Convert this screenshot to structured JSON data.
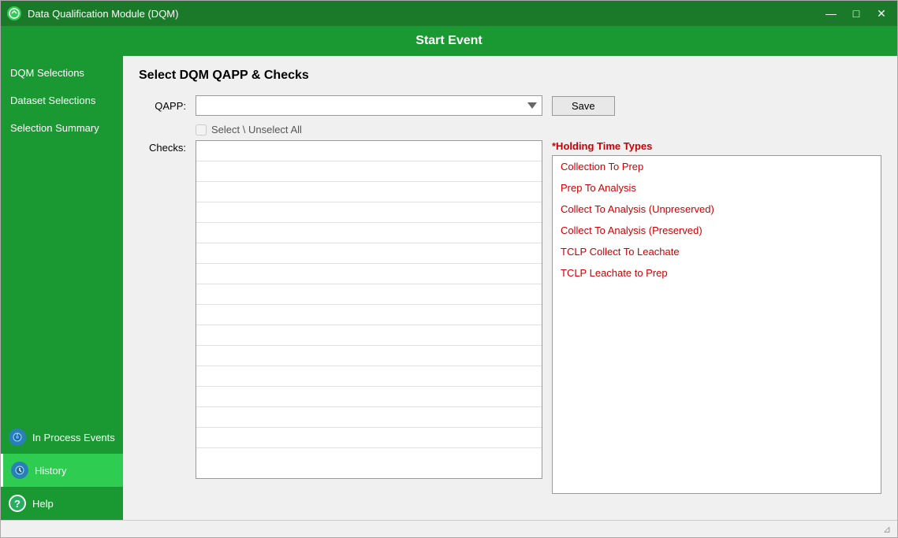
{
  "window": {
    "title": "Data Qualification Module (DQM)",
    "app_header": "Start Event"
  },
  "title_bar_controls": {
    "minimize": "—",
    "maximize": "□",
    "close": "✕"
  },
  "sidebar": {
    "nav_items": [
      {
        "label": "DQM Selections",
        "id": "dqm-selections"
      },
      {
        "label": "Dataset Selections",
        "id": "dataset-selections"
      },
      {
        "label": "Selection Summary",
        "id": "selection-summary"
      }
    ],
    "bottom_items": [
      {
        "label": "In Process Events",
        "id": "in-process-events",
        "icon": "⚙"
      },
      {
        "label": "History",
        "id": "history",
        "icon": "🕐"
      },
      {
        "label": "Help",
        "id": "help",
        "icon": "?"
      }
    ]
  },
  "main": {
    "section_title": "Select DQM QAPP & Checks",
    "qapp_label": "QAPP:",
    "qapp_placeholder": "",
    "select_unselect_label": "Select \\ Unselect All",
    "checks_label": "Checks:",
    "save_button_label": "Save",
    "holding_time_title": "*Holding Time Types",
    "holding_time_items": [
      {
        "label": "Collection To Prep",
        "color": "red"
      },
      {
        "label": "Prep To Analysis",
        "color": "red"
      },
      {
        "label": "Collect To Analysis (Unpreserved)",
        "color": "red"
      },
      {
        "label": "Collect To Analysis (Preserved)",
        "color": "red"
      },
      {
        "label": "TCLP Collect To Leachate",
        "color": "red"
      },
      {
        "label": "TCLP Leachate to Prep",
        "color": "red"
      }
    ],
    "checks_rows": 16
  },
  "status_bar": {
    "resize_icon": "⊿"
  }
}
